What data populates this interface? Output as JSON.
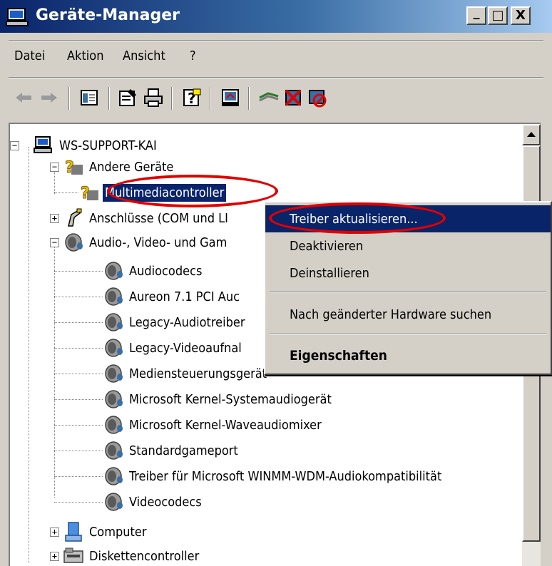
{
  "window": {
    "title": "Geräte-Manager",
    "controls": {
      "minimize": "_",
      "maximize": "□",
      "close": "X"
    }
  },
  "menubar": {
    "items": [
      {
        "label": "Datei"
      },
      {
        "label": "Aktion"
      },
      {
        "label": "Ansicht"
      },
      {
        "label": "?"
      }
    ]
  },
  "toolbar": {
    "icons": [
      "back-arrow-icon",
      "forward-arrow-icon",
      "console-tree-icon",
      "properties-icon",
      "print-icon",
      "help-icon",
      "scan-hardware-icon",
      "update-driver-icon",
      "uninstall-icon",
      "disable-icon"
    ]
  },
  "tree": {
    "root": "WS-SUPPORT-KAI",
    "other_devices": "Andere Geräte",
    "multimedia_controller": "Multimediacontroller",
    "ports": "Anschlüsse (COM und LI",
    "audio_video_games": "Audio-, Video- und Gam",
    "audio_children": [
      "Audiocodecs",
      "Aureon 7.1 PCI Auc",
      "Legacy-Audiotreiber",
      "Legacy-Videoaufnal",
      "Mediensteuerungsgerät",
      "Microsoft Kernel-Systemaudiogerät",
      "Microsoft Kernel-Waveaudiomixer",
      "Standardgameport",
      "Treiber für Microsoft WINMM-WDM-Audiokompatibilität",
      "Videocodecs"
    ],
    "computer": "Computer",
    "disk_controller": "Diskettencontroller",
    "expander_plus": "+",
    "expander_minus": "−"
  },
  "context_menu": {
    "update_driver": "Treiber aktualisieren...",
    "disable": "Deaktivieren",
    "uninstall": "Deinstallieren",
    "scan": "Nach geänderter Hardware suchen",
    "properties": "Eigenschaften"
  },
  "colors": {
    "selection": "#0a246a",
    "annotation": "#e00000",
    "face": "#d4d0c8"
  }
}
